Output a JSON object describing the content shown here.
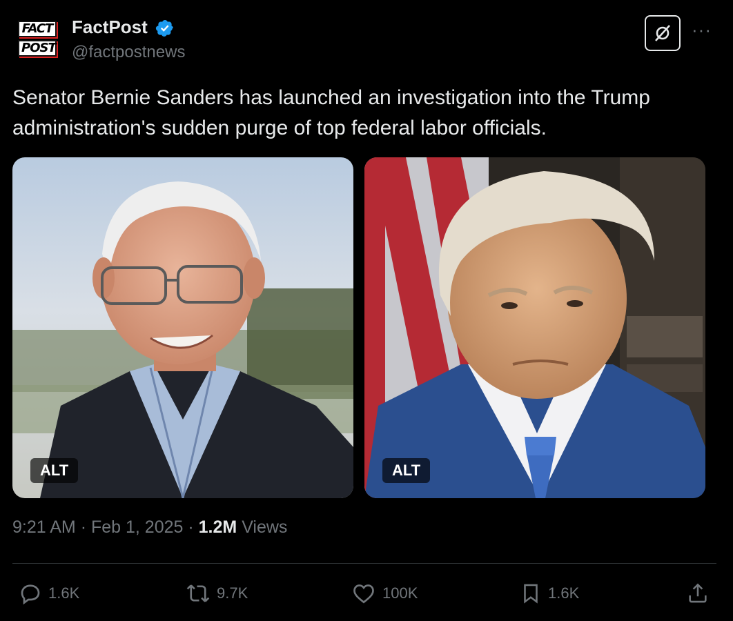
{
  "author": {
    "logo_line1": "FACT",
    "logo_line2": "POST",
    "name": "FactPost",
    "handle": "@factpostnews",
    "verified_icon": "verified-badge-icon",
    "verified_color": "#1d9bf0"
  },
  "tweet": {
    "text": "Senator Bernie Sanders has launched an investigation into the Trump administration's sudden purge of top federal labor officials."
  },
  "media": [
    {
      "alt_label": "ALT",
      "subject": "photo-portrait"
    },
    {
      "alt_label": "ALT",
      "subject": "photo-portrait"
    }
  ],
  "meta": {
    "time": "9:21 AM",
    "date": "Feb 1, 2025",
    "views_count": "1.2M",
    "views_label": "Views",
    "separator": "·"
  },
  "actions": {
    "replies": "1.6K",
    "reposts": "9.7K",
    "likes": "100K",
    "bookmarks": "1.6K"
  },
  "icons": {
    "grok": "grok-icon",
    "more": "more-icon",
    "reply": "reply-icon",
    "repost": "repost-icon",
    "like": "like-icon",
    "bookmark": "bookmark-icon",
    "share": "share-icon"
  }
}
